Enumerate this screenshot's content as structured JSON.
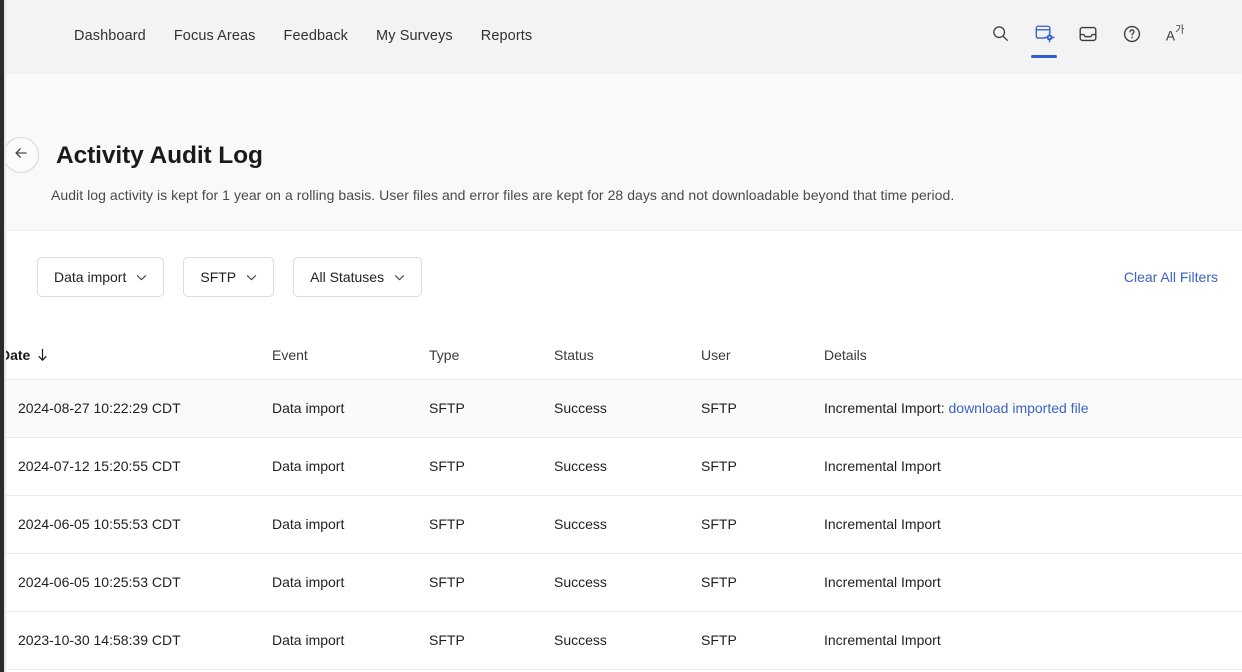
{
  "nav": {
    "links": [
      {
        "label": "Dashboard"
      },
      {
        "label": "Focus Areas"
      },
      {
        "label": "Feedback"
      },
      {
        "label": "My Surveys"
      },
      {
        "label": "Reports"
      }
    ],
    "actions": [
      {
        "icon": "search-icon",
        "active": false
      },
      {
        "icon": "admin-panel-gear-icon",
        "active": true
      },
      {
        "icon": "inbox-icon",
        "active": false
      },
      {
        "icon": "help-circle-icon",
        "active": false
      },
      {
        "icon": "translate-icon",
        "active": false
      }
    ],
    "accent_color": "#2f5fd0",
    "background_color": "#f3f3f3"
  },
  "header": {
    "back_label": "Back",
    "title": "Activity Audit Log",
    "description": "Audit log activity is kept for 1 year on a rolling basis. User files and error files are kept for 28 days and not downloadable beyond that time period.",
    "background_color": "#f9f9f9"
  },
  "filters": {
    "buttons": [
      {
        "label": "Data import",
        "name": "filter-event-type"
      },
      {
        "label": "SFTP",
        "name": "filter-source"
      },
      {
        "label": "All Statuses",
        "name": "filter-status"
      }
    ],
    "clear_label": "Clear All Filters",
    "link_color": "#3b62c4"
  },
  "table": {
    "columns": [
      {
        "label": "Date",
        "key": "date",
        "sorted": true,
        "sort_direction": "desc"
      },
      {
        "label": "Event",
        "key": "event",
        "sorted": false
      },
      {
        "label": "Type",
        "key": "type",
        "sorted": false
      },
      {
        "label": "Status",
        "key": "status",
        "sorted": false
      },
      {
        "label": "User",
        "key": "user",
        "sorted": false
      },
      {
        "label": "Details",
        "key": "details",
        "sorted": false
      }
    ],
    "rows": [
      {
        "date": "2024-08-27 10:22:29 CDT",
        "event": "Data import",
        "type": "SFTP",
        "status": "Success",
        "user": "SFTP",
        "details": "Incremental Import:",
        "details_link": "download imported file",
        "highlighted": true
      },
      {
        "date": "2024-07-12 15:20:55 CDT",
        "event": "Data import",
        "type": "SFTP",
        "status": "Success",
        "user": "SFTP",
        "details": "Incremental Import",
        "details_link": "",
        "highlighted": false
      },
      {
        "date": "2024-06-05 10:55:53 CDT",
        "event": "Data import",
        "type": "SFTP",
        "status": "Success",
        "user": "SFTP",
        "details": "Incremental Import",
        "details_link": "",
        "highlighted": false
      },
      {
        "date": "2024-06-05 10:25:53 CDT",
        "event": "Data import",
        "type": "SFTP",
        "status": "Success",
        "user": "SFTP",
        "details": "Incremental Import",
        "details_link": "",
        "highlighted": false
      },
      {
        "date": "2023-10-30 14:58:39 CDT",
        "event": "Data import",
        "type": "SFTP",
        "status": "Success",
        "user": "SFTP",
        "details": "Incremental Import",
        "details_link": "",
        "highlighted": false
      }
    ]
  }
}
